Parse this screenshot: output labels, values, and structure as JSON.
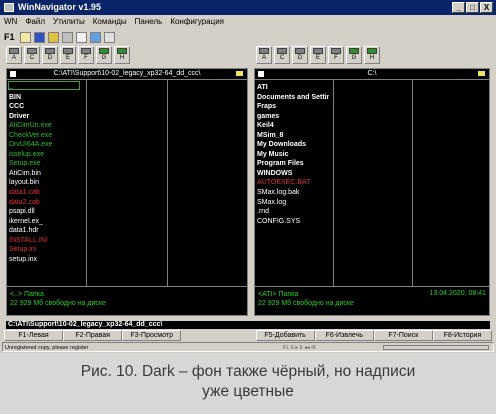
{
  "window": {
    "title": "WinNavigator v1.95",
    "minimize": "_",
    "maximize": "□",
    "close": "X"
  },
  "menu": [
    "WN",
    "Файл",
    "Утилиты",
    "Команды",
    "Панель",
    "Конфигурация"
  ],
  "toolbar": {
    "f1": "F1"
  },
  "drive_buttons": [
    "A",
    "C",
    "D",
    "E",
    "F",
    "G",
    "H"
  ],
  "left_panel": {
    "path": "C:\\ATI\\Support\\10-02_legacy_xp32-64_dd_ccc\\",
    "files": [
      {
        "name": "..",
        "color": "white",
        "bold": false
      },
      {
        "name": "BIN",
        "color": "white",
        "bold": true
      },
      {
        "name": "CCC",
        "color": "white",
        "bold": true
      },
      {
        "name": "Driver",
        "color": "white",
        "bold": true
      },
      {
        "name": "AtiCimUn.exe",
        "color": "green",
        "bold": false
      },
      {
        "name": "CheckVer.exe",
        "color": "green",
        "bold": false
      },
      {
        "name": "DrvUI64A.exe",
        "color": "green",
        "bold": false
      },
      {
        "name": "isselup.exe",
        "color": "green",
        "bold": false
      },
      {
        "name": "Setup.exe",
        "color": "green",
        "bold": false
      },
      {
        "name": "AtiCim.bin",
        "color": "white",
        "bold": false
      },
      {
        "name": "layout.bin",
        "color": "white",
        "bold": false
      },
      {
        "name": "data1.cab",
        "color": "red",
        "bold": false
      },
      {
        "name": "data2.cab",
        "color": "red",
        "bold": false
      },
      {
        "name": "psapi.dll",
        "color": "white",
        "bold": false
      },
      {
        "name": "ikernel.ex_",
        "color": "white",
        "bold": false
      },
      {
        "name": "data1.hdr",
        "color": "white",
        "bold": false
      },
      {
        "name": "INSTALL.INI",
        "color": "red",
        "bold": false
      },
      {
        "name": "Setup.ini",
        "color": "red",
        "bold": false
      },
      {
        "name": "setup.inx",
        "color": "white",
        "bold": false
      }
    ],
    "status_line1": "<..> Папка",
    "status_line2": "22 929 Мб свободно на диске",
    "status_date": ""
  },
  "right_panel": {
    "path": "C:\\",
    "files": [
      {
        "name": "ATI",
        "color": "white",
        "bold": true
      },
      {
        "name": "Documents and Settings",
        "color": "white",
        "bold": true
      },
      {
        "name": "Fraps",
        "color": "white",
        "bold": true
      },
      {
        "name": "games",
        "color": "white",
        "bold": true
      },
      {
        "name": "Keil4",
        "color": "white",
        "bold": true
      },
      {
        "name": "MSim_8",
        "color": "white",
        "bold": true
      },
      {
        "name": "My Downloads",
        "color": "white",
        "bold": true
      },
      {
        "name": "My Music",
        "color": "white",
        "bold": true
      },
      {
        "name": "Program Files",
        "color": "white",
        "bold": true
      },
      {
        "name": "WINDOWS",
        "color": "white",
        "bold": true
      },
      {
        "name": "AUTOEXEC.BAT",
        "color": "red",
        "bold": false
      },
      {
        "name": "SMax.log.bak",
        "color": "white",
        "bold": false
      },
      {
        "name": "SMax.log",
        "color": "white",
        "bold": false
      },
      {
        "name": ".rnd",
        "color": "white",
        "bold": false
      },
      {
        "name": "CONFIG.SYS",
        "color": "white",
        "bold": false
      }
    ],
    "status_line1": "<ATI> Папка",
    "status_line2": "22 929 Мб свободно на диске",
    "status_date": "13.04.2020, 08:41"
  },
  "command_line": "C:\\ATI\\Support\\10-02_legacy_xp32-64_dd_ccc\\",
  "fkeys": {
    "f1": "F1-Левая",
    "f2": "F2-Правая",
    "f3": "F3-Просмотр",
    "f5": "F5-Добавить",
    "f6": "F6-Извлечь",
    "f7": "F7-Поиск",
    "f8": "F8-История"
  },
  "statusbar": {
    "text": "Unregistered copy, please register",
    "mid": "FL   II ▸ II ◂◂ III"
  },
  "caption": {
    "line1": "Рис. 10. Dark – фон также чёрный, но надписи",
    "line2": "уже цветные"
  },
  "colors": {
    "panel_bg": "#000000",
    "white_text": "#ffffff",
    "green_text": "#22c022",
    "red_text": "#e03030",
    "title_bar": "#0a246a"
  }
}
